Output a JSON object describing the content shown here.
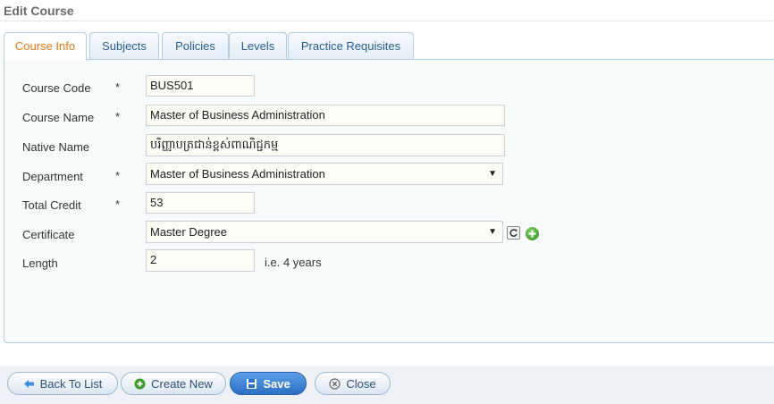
{
  "page": {
    "title": "Edit Course"
  },
  "tabs": [
    {
      "label": "Course Info",
      "active": true
    },
    {
      "label": "Subjects"
    },
    {
      "label": "Policies"
    },
    {
      "label": "Levels"
    },
    {
      "label": "Practice Requisites"
    }
  ],
  "form": {
    "course_code": {
      "label": "Course Code",
      "required": "*",
      "value": "BUS501"
    },
    "course_name": {
      "label": "Course Name",
      "required": "*",
      "value": "Master of Business Administration"
    },
    "native_name": {
      "label": "Native Name",
      "value": "បរិញ្ញាបត្រជាន់ខ្ពស់ពាណិជ្ជកម្ម"
    },
    "department": {
      "label": "Department",
      "required": "*",
      "value": "Master of Business Administration"
    },
    "total_credit": {
      "label": "Total Credit",
      "required": "*",
      "value": "53"
    },
    "certificate": {
      "label": "Certificate",
      "value": "Master Degree"
    },
    "length": {
      "label": "Length",
      "value": "2",
      "hint": "i.e. 4 years"
    }
  },
  "buttons": {
    "back": "Back To List",
    "create": "Create New",
    "save": "Save",
    "close": "Close"
  },
  "icons": {
    "back": "left-arrow-icon",
    "create": "plus-circle-icon",
    "save": "floppy-disk-icon",
    "close": "close-circle-icon",
    "refresh": "refresh-icon",
    "add": "add-circle-icon",
    "dropdown": "dropdown-arrow-icon"
  },
  "colors": {
    "active_tab_text": "#e07b12",
    "tab_text": "#2a5d8f",
    "primary_button": "#2c6fc4",
    "add_icon": "#2f8a1e"
  }
}
